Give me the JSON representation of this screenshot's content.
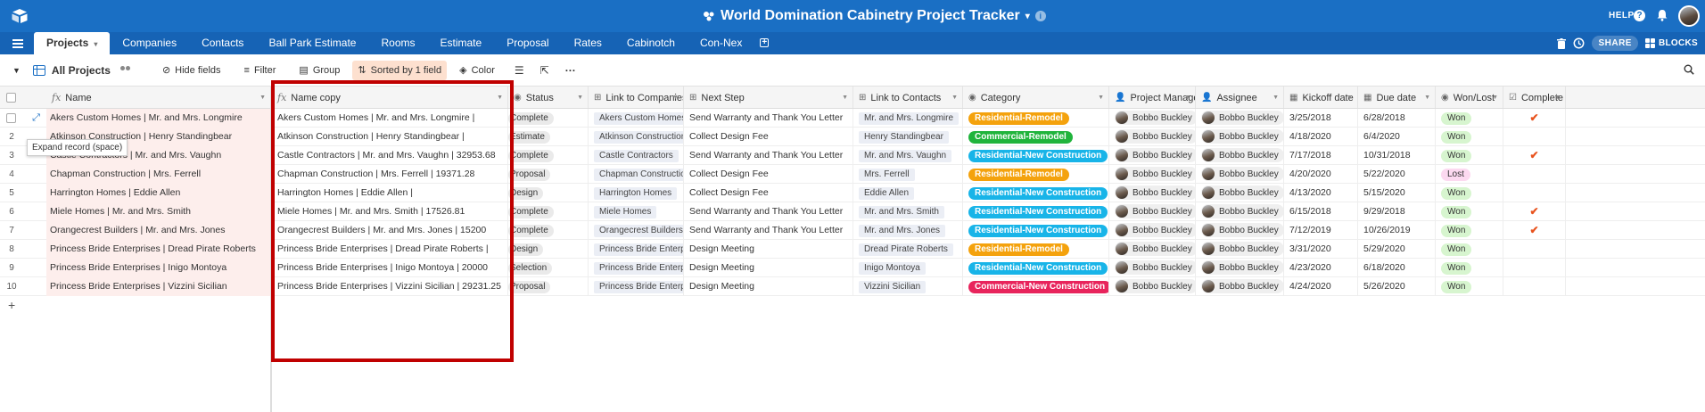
{
  "app": {
    "base_title": "World Domination Cabinetry Project Tracker",
    "help_label": "HELP",
    "share_label": "SHARE",
    "blocks_label": "BLOCKS"
  },
  "tabs": [
    {
      "label": "Projects",
      "active": true
    },
    {
      "label": "Companies"
    },
    {
      "label": "Contacts"
    },
    {
      "label": "Ball Park Estimate"
    },
    {
      "label": "Rooms"
    },
    {
      "label": "Estimate"
    },
    {
      "label": "Proposal"
    },
    {
      "label": "Rates"
    },
    {
      "label": "Cabinotch"
    },
    {
      "label": "Con-Nex"
    }
  ],
  "view": {
    "name": "All Projects",
    "hide_fields": "Hide fields",
    "filter": "Filter",
    "group": "Group",
    "sorted": "Sorted by 1 field",
    "color": "Color"
  },
  "tooltip": "Expand record (space)",
  "columns": {
    "name": "Name",
    "name_copy": "Name copy",
    "status": "Status",
    "link_companies": "Link to Companies",
    "next_step": "Next Step",
    "link_contacts": "Link to Contacts",
    "category": "Category",
    "project_manager": "Project Manager",
    "assignee": "Assignee",
    "kickoff": "Kickoff date",
    "due": "Due date",
    "won_lost": "Won/Lost",
    "complete": "Complete"
  },
  "colors": {
    "Residential-Remodel": "#f4a20d",
    "Commercial-Remodel": "#20b43c",
    "Residential-New Construction": "#18b4e8",
    "Commercial-New Construction": "#e8245c",
    "won_bg": "#d7f5cf",
    "lost_bg": "#fcd9f0"
  },
  "rows": [
    {
      "num": "1",
      "name": "Akers Custom Homes | Mr. and Mrs. Longmire",
      "name_copy": "Akers Custom Homes | Mr. and Mrs. Longmire |",
      "status": "Complete",
      "company": "Akers Custom Homes",
      "next_step": "Send Warranty and Thank You Letter",
      "contact": "Mr. and Mrs. Longmire",
      "category": "Residential-Remodel",
      "pm": "Bobbo Buckley",
      "assignee": "Bobbo Buckley",
      "kickoff": "3/25/2018",
      "due": "6/28/2018",
      "won": "Won",
      "complete": "✔"
    },
    {
      "num": "2",
      "name": "Atkinson Construction | Henry Standingbear",
      "name_copy": "Atkinson Construction | Henry Standingbear |",
      "status": "Estimate",
      "company": "Atkinson Construction",
      "next_step": "Collect Design Fee",
      "contact": "Henry Standingbear",
      "category": "Commercial-Remodel",
      "pm": "Bobbo Buckley",
      "assignee": "Bobbo Buckley",
      "kickoff": "4/18/2020",
      "due": "6/4/2020",
      "won": "Won",
      "complete": ""
    },
    {
      "num": "3",
      "name": "Castle Contractors | Mr. and Mrs. Vaughn",
      "name_copy": "Castle Contractors | Mr. and Mrs. Vaughn | 32953.68",
      "status": "Complete",
      "company": "Castle Contractors",
      "next_step": "Send Warranty and Thank You Letter",
      "contact": "Mr. and Mrs. Vaughn",
      "category": "Residential-New Construction",
      "pm": "Bobbo Buckley",
      "assignee": "Bobbo Buckley",
      "kickoff": "7/17/2018",
      "due": "10/31/2018",
      "won": "Won",
      "complete": "✔"
    },
    {
      "num": "4",
      "name": "Chapman Construction | Mrs. Ferrell",
      "name_copy": "Chapman Construction | Mrs. Ferrell | 19371.28",
      "status": "Proposal",
      "company": "Chapman Construction",
      "next_step": "Collect Design Fee",
      "contact": "Mrs. Ferrell",
      "category": "Residential-Remodel",
      "pm": "Bobbo Buckley",
      "assignee": "Bobbo Buckley",
      "kickoff": "4/20/2020",
      "due": "5/22/2020",
      "won": "Lost",
      "complete": ""
    },
    {
      "num": "5",
      "name": "Harrington Homes | Eddie Allen",
      "name_copy": "Harrington Homes | Eddie Allen |",
      "status": "Design",
      "company": "Harrington Homes",
      "next_step": "Collect Design Fee",
      "contact": "Eddie Allen",
      "category": "Residential-New Construction",
      "pm": "Bobbo Buckley",
      "assignee": "Bobbo Buckley",
      "kickoff": "4/13/2020",
      "due": "5/15/2020",
      "won": "Won",
      "complete": ""
    },
    {
      "num": "6",
      "name": "Miele Homes | Mr. and Mrs. Smith",
      "name_copy": "Miele Homes | Mr. and Mrs. Smith | 17526.81",
      "status": "Complete",
      "company": "Miele Homes",
      "next_step": "Send Warranty and Thank You Letter",
      "contact": "Mr. and Mrs. Smith",
      "category": "Residential-New Construction",
      "pm": "Bobbo Buckley",
      "assignee": "Bobbo Buckley",
      "kickoff": "6/15/2018",
      "due": "9/29/2018",
      "won": "Won",
      "complete": "✔"
    },
    {
      "num": "7",
      "name": "Orangecrest Builders | Mr. and Mrs. Jones",
      "name_copy": "Orangecrest Builders | Mr. and Mrs. Jones | 15200",
      "status": "Complete",
      "company": "Orangecrest Builders",
      "next_step": "Send Warranty and Thank You Letter",
      "contact": "Mr. and Mrs. Jones",
      "category": "Residential-New Construction",
      "pm": "Bobbo Buckley",
      "assignee": "Bobbo Buckley",
      "kickoff": "7/12/2019",
      "due": "10/26/2019",
      "won": "Won",
      "complete": "✔"
    },
    {
      "num": "8",
      "name": "Princess Bride Enterprises | Dread Pirate Roberts",
      "name_copy": "Princess Bride Enterprises | Dread Pirate Roberts |",
      "status": "Design",
      "company": "Princess Bride Enterprises",
      "next_step": "Design Meeting",
      "contact": "Dread Pirate Roberts",
      "category": "Residential-Remodel",
      "pm": "Bobbo Buckley",
      "assignee": "Bobbo Buckley",
      "kickoff": "3/31/2020",
      "due": "5/29/2020",
      "won": "Won",
      "complete": ""
    },
    {
      "num": "9",
      "name": "Princess Bride Enterprises | Inigo Montoya",
      "name_copy": "Princess Bride Enterprises | Inigo Montoya | 20000",
      "status": "Selection",
      "company": "Princess Bride Enterprises",
      "next_step": "Design Meeting",
      "contact": "Inigo Montoya",
      "category": "Residential-New Construction",
      "pm": "Bobbo Buckley",
      "assignee": "Bobbo Buckley",
      "kickoff": "4/23/2020",
      "due": "6/18/2020",
      "won": "Won",
      "complete": ""
    },
    {
      "num": "10",
      "name": "Princess Bride Enterprises | Vizzini Sicilian",
      "name_copy": "Princess Bride Enterprises | Vizzini Sicilian | 29231.25",
      "status": "Proposal",
      "company": "Princess Bride Enterprises",
      "next_step": "Design Meeting",
      "contact": "Vizzini Sicilian",
      "category": "Commercial-New Construction",
      "pm": "Bobbo Buckley",
      "assignee": "Bobbo Buckley",
      "kickoff": "4/24/2020",
      "due": "5/26/2020",
      "won": "Won",
      "complete": ""
    }
  ],
  "add_row": "+"
}
